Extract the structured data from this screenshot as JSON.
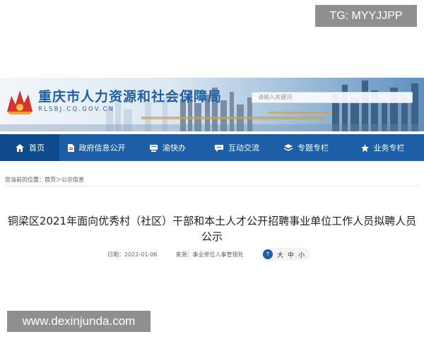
{
  "watermarks": {
    "top": "TG: MYYJJPP",
    "bottom": "www.dexinjunda.com"
  },
  "header": {
    "site_title": "重庆市人力资源和社会保障局",
    "site_url": "RLSBJ.CQ.GOV.CN",
    "search_placeholder": "请输入关键词"
  },
  "nav": {
    "items": [
      {
        "label": "首页",
        "icon": "home-icon",
        "active": true
      },
      {
        "label": "政府信息公开",
        "icon": "document-icon",
        "active": false
      },
      {
        "label": "渝快办",
        "icon": "service-icon",
        "active": false
      },
      {
        "label": "互动交流",
        "icon": "chat-icon",
        "active": false
      },
      {
        "label": "专题专栏",
        "icon": "layers-icon",
        "active": false
      },
      {
        "label": "业务专栏",
        "icon": "star-icon",
        "active": false
      }
    ]
  },
  "breadcrumb": "您当前的位置：首页＞公示信息",
  "article": {
    "title": "铜梁区2021年面向优秀村（社区）干部和本土人才公开招聘事业单位工作人员拟聘人员公示",
    "date": "日期：2022-01-06",
    "source": "来源：事业单位人事管理处",
    "font_size_icon": "T",
    "font_sizes": [
      "大",
      "中",
      "小"
    ]
  },
  "colors": {
    "nav_bg": "#1c5ea7",
    "nav_active": "#0f4a8c",
    "title_blue": "#1e5fa8"
  }
}
